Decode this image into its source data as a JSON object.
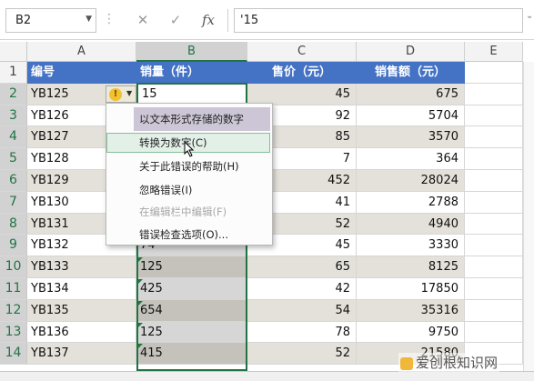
{
  "formula_bar": {
    "name_box": "B2",
    "cancel_icon": "✕",
    "enter_icon": "✓",
    "fx_label": "fx",
    "formula_value": "'15"
  },
  "columns": [
    "A",
    "B",
    "C",
    "D",
    "E"
  ],
  "rows": [
    "1",
    "2",
    "3",
    "4",
    "5",
    "6",
    "7",
    "8",
    "9",
    "10",
    "11",
    "12",
    "13",
    "14"
  ],
  "header": [
    "编号",
    "销量（件）",
    "售价（元）",
    "销售额（元）"
  ],
  "data": [
    {
      "id": "YB125",
      "qty": "15",
      "price": "45",
      "sales": "675"
    },
    {
      "id": "YB126",
      "qty": "",
      "price": "92",
      "sales": "5704"
    },
    {
      "id": "YB127",
      "qty": "",
      "price": "85",
      "sales": "3570"
    },
    {
      "id": "YB128",
      "qty": "",
      "price": "7",
      "sales": "364"
    },
    {
      "id": "YB129",
      "qty": "",
      "price": "452",
      "sales": "28024"
    },
    {
      "id": "YB130",
      "qty": "",
      "price": "41",
      "sales": "2788"
    },
    {
      "id": "YB131",
      "qty": "",
      "price": "52",
      "sales": "4940"
    },
    {
      "id": "YB132",
      "qty": "74",
      "price": "45",
      "sales": "3330"
    },
    {
      "id": "YB133",
      "qty": "125",
      "price": "65",
      "sales": "8125"
    },
    {
      "id": "YB134",
      "qty": "425",
      "price": "42",
      "sales": "17850"
    },
    {
      "id": "YB135",
      "qty": "654",
      "price": "54",
      "sales": "35316"
    },
    {
      "id": "YB136",
      "qty": "125",
      "price": "78",
      "sales": "9750"
    },
    {
      "id": "YB137",
      "qty": "415",
      "price": "52",
      "sales": "21580"
    }
  ],
  "context_menu": {
    "title": "以文本形式存储的数字",
    "items": [
      "转换为数字(C)",
      "关于此错误的帮助(H)",
      "忽略错误(I)",
      "在编辑栏中编辑(F)",
      "错误检查选项(O)..."
    ],
    "disabled_index": 3,
    "highlighted_index": 0
  },
  "warning_icon": "!",
  "watermark": "爱创根知识网",
  "colors": {
    "header_blue": "#4472c4",
    "band": "#e3e1d9",
    "selection_green": "#217346",
    "error_triangle": "#1e7a3c"
  },
  "icons": {
    "name_box_dropdown": "chevron-down-icon",
    "warning": "warning-icon",
    "cursor": "mouse-cursor-icon"
  }
}
